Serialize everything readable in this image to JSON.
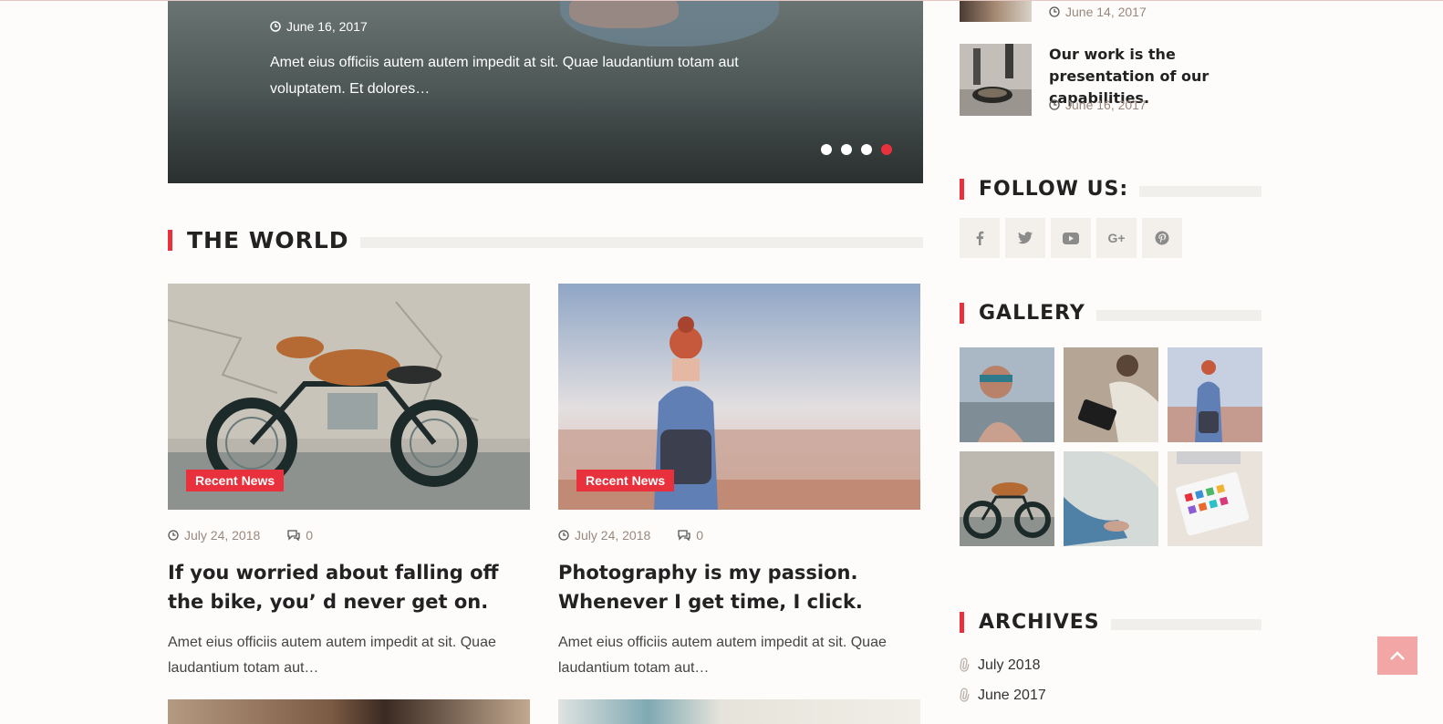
{
  "slider": {
    "date": "June 16, 2017",
    "excerpt": "Amet eius officiis autem autem impedit at sit. Quae laudantium totam aut voluptatem. Et dolores…",
    "dots": 4,
    "active_dot": 4
  },
  "section": {
    "title": "THE WORLD"
  },
  "cards": [
    {
      "badge": "Recent News",
      "date": "July 24, 2018",
      "comments": "0",
      "title": "If you worried about falling off the bike, you’ d never get on.",
      "excerpt": "Amet eius officiis autem autem impedit at sit. Quae laudantium totam aut…"
    },
    {
      "badge": "Recent News",
      "date": "July 24, 2018",
      "comments": "0",
      "title": "Photography is my passion. Whenever I get time, I click.",
      "excerpt": "Amet eius officiis autem autem impedit at sit. Quae laudantium totam aut…"
    }
  ],
  "sidebar": {
    "posts": [
      {
        "title": "",
        "date": "June 14, 2017"
      },
      {
        "title": "Our work is the presentation of our capabilities.",
        "date": "June 16, 2017"
      }
    ],
    "follow": {
      "title": "FOLLOW US:",
      "icons": [
        "facebook-icon",
        "twitter-icon",
        "youtube-icon",
        "google-plus-icon",
        "pinterest-icon"
      ]
    },
    "gallery": {
      "title": "GALLERY",
      "count": 6
    },
    "archives": {
      "title": "ARCHIVES",
      "items": [
        "July 2018",
        "June 2017"
      ]
    }
  },
  "colors": {
    "accent": "#e8313c",
    "meta": "#99887d",
    "totop": "#f2a7a6"
  }
}
